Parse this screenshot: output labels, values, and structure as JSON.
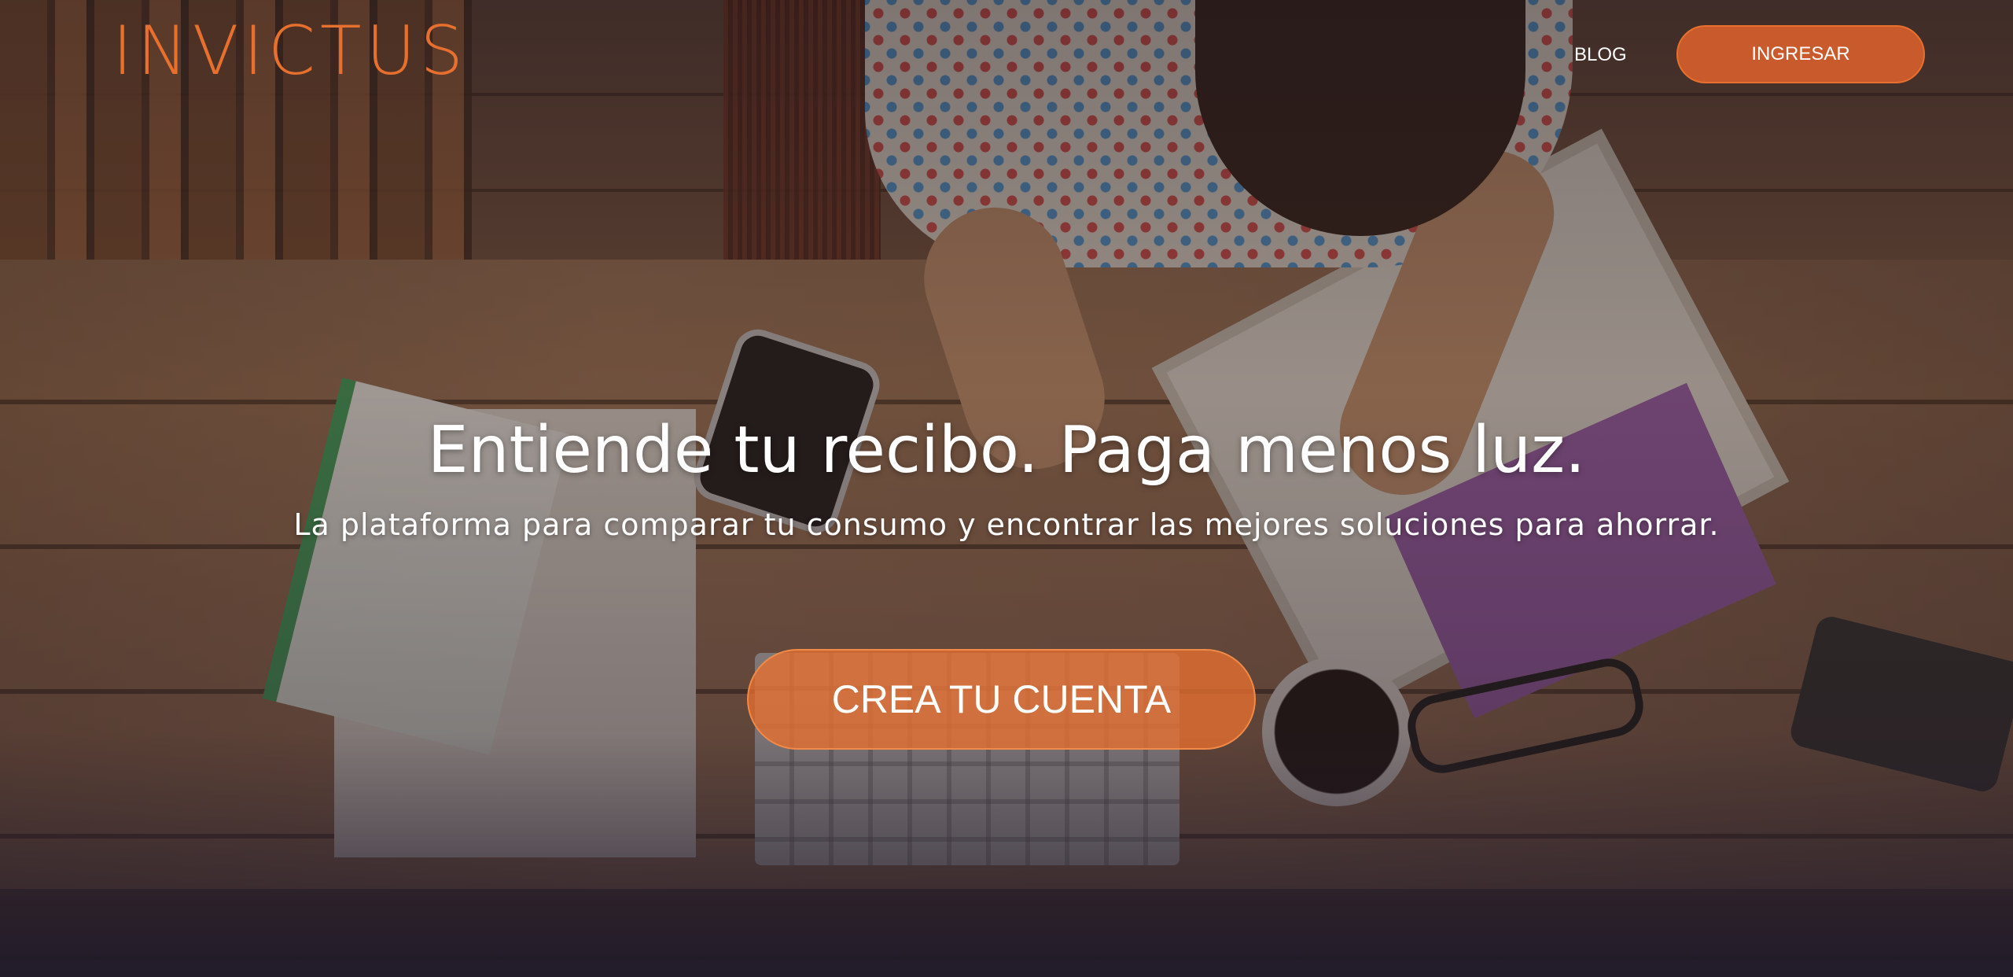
{
  "brand": {
    "logo_text": "INVICTUS",
    "accent_color": "#e8702f"
  },
  "nav": {
    "blog_label": "BLOG",
    "login_label": "INGRESAR"
  },
  "hero": {
    "headline": "Entiende tu recibo. Paga menos luz.",
    "subheadline": "La plataforma para comparar tu consumo y encontrar las mejores soluciones para ahorrar.",
    "cta_label": "CREA TU CUENTA"
  }
}
